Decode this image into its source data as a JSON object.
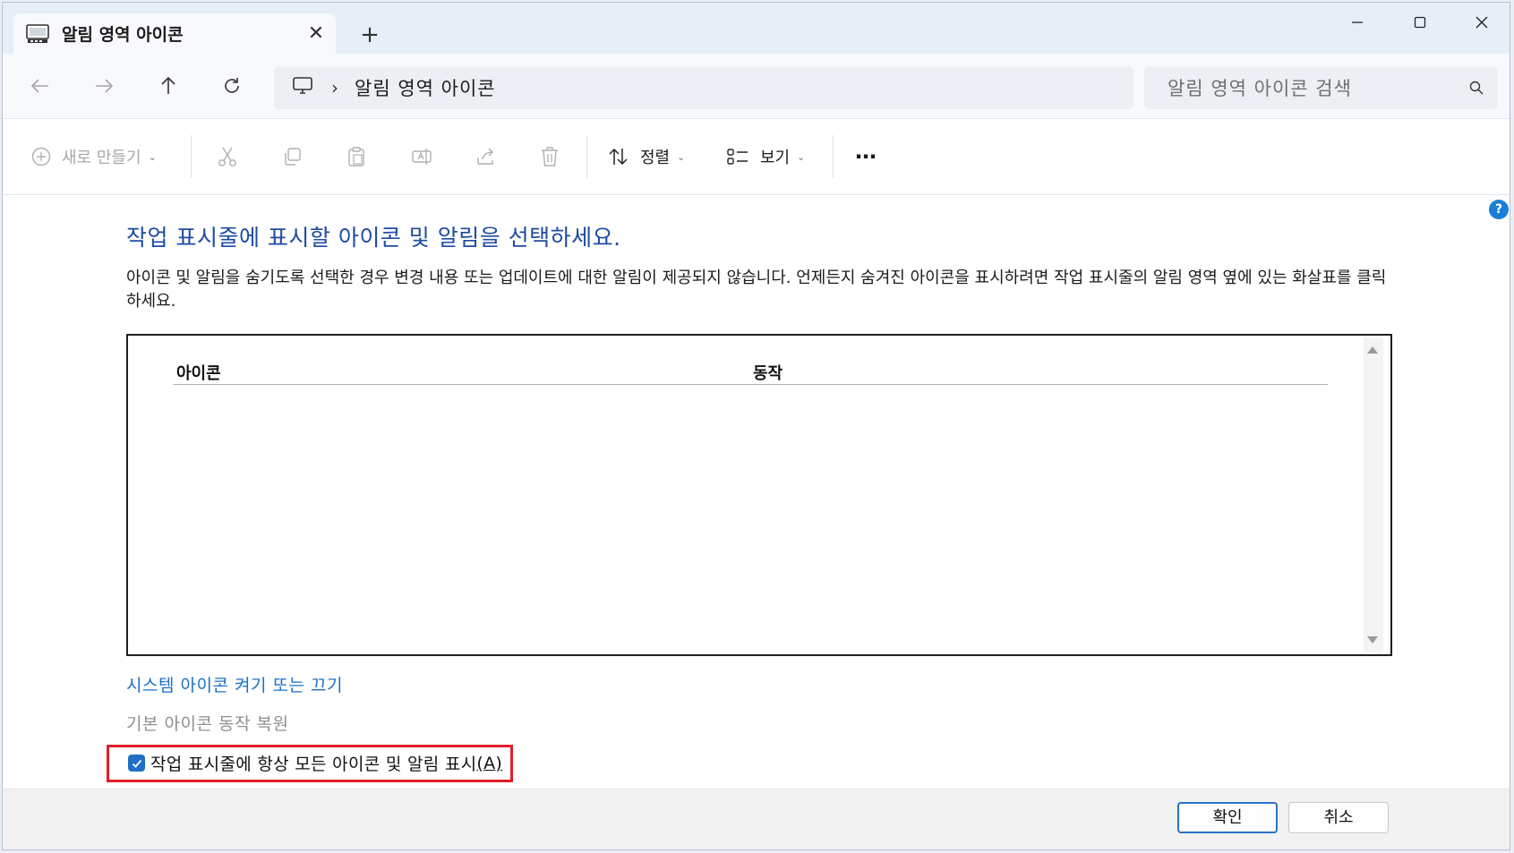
{
  "window": {
    "tab_title": "알림 영역 아이콘",
    "tab_close": "✕",
    "new_tab": "+",
    "controls": {
      "minimize": "—",
      "maximize": "☐",
      "close": "✕"
    }
  },
  "nav": {
    "breadcrumb": [
      "알림 영역 아이콘"
    ],
    "breadcrumb_sep": "›",
    "search_placeholder": "알림 영역 아이콘 검색"
  },
  "toolbar": {
    "new": "새로 만들기",
    "sort": "정렬",
    "view": "보기",
    "more": "⋯"
  },
  "content": {
    "heading": "작업 표시줄에 표시할 아이콘 및 알림을 선택하세요.",
    "description": "아이콘 및 알림을 숨기도록 선택한 경우 변경 내용 또는 업데이트에 대한 알림이 제공되지 않습니다. 언제든지 숨겨진 아이콘을 표시하려면 작업 표시줄의 알림 영역 옆에 있는 화살표를 클릭하세요.",
    "columns": {
      "icon": "아이콘",
      "action": "동작"
    },
    "link_system_icons": "시스템 아이콘 켜기 또는 끄기",
    "restore_default": "기본 아이콘 동작 복원",
    "checkbox_label": "작업 표시줄에 항상 모든 아이콘 및 알림 표시",
    "checkbox_accel": "(A)",
    "checkbox_checked": true
  },
  "footer": {
    "ok": "확인",
    "cancel": "취소"
  },
  "colors": {
    "accent": "#1f6fc4",
    "heading": "#1e4ba3",
    "link": "#1a6fc9",
    "highlight": "#e0202a"
  }
}
